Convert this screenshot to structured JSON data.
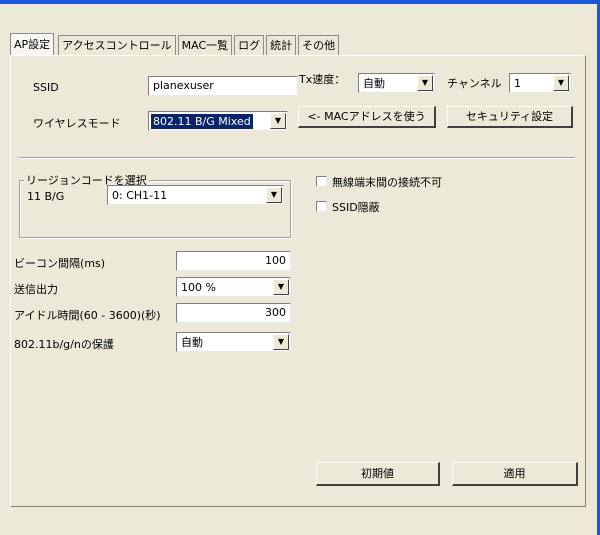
{
  "tabs": [
    {
      "label": "AP設定",
      "active": true
    },
    {
      "label": "アクセスコントロール"
    },
    {
      "label": "MAC一覧"
    },
    {
      "label": "ログ"
    },
    {
      "label": "統計"
    },
    {
      "label": "その他"
    }
  ],
  "ssid": {
    "label": "SSID",
    "value": "planexuser"
  },
  "tx_rate": {
    "label": "Tx速度：",
    "value": "自動"
  },
  "channel": {
    "label": "チャンネル",
    "value": "1"
  },
  "wireless_mode": {
    "label": "ワイヤレスモード",
    "value": "802.11 B/G Mixed"
  },
  "buttons": {
    "use_mac": "<- MACアドレスを使う",
    "security": "セキュリティ設定",
    "defaults": "初期値",
    "apply": "適用"
  },
  "region": {
    "group_title": "リージョンコードを選択",
    "band_label": "11 B/G",
    "value": "0: CH1-11"
  },
  "options": {
    "no_inter_client": "無線端末間の接続不可",
    "hide_ssid": "SSID隠蔽"
  },
  "beacon": {
    "label": "ビーコン間隔(ms)",
    "value": "100"
  },
  "tx_power": {
    "label": "送信出力",
    "value": "100 %"
  },
  "idle_time": {
    "label": "アイドル時間(60 - 3600)(秒)",
    "value": "300"
  },
  "protection": {
    "label": "802.11b/g/nの保護",
    "value": "自動"
  },
  "colors": {
    "titlebar": "#1957d8",
    "dialog_bg": "#ece9d8",
    "selection": "#0a246a"
  }
}
